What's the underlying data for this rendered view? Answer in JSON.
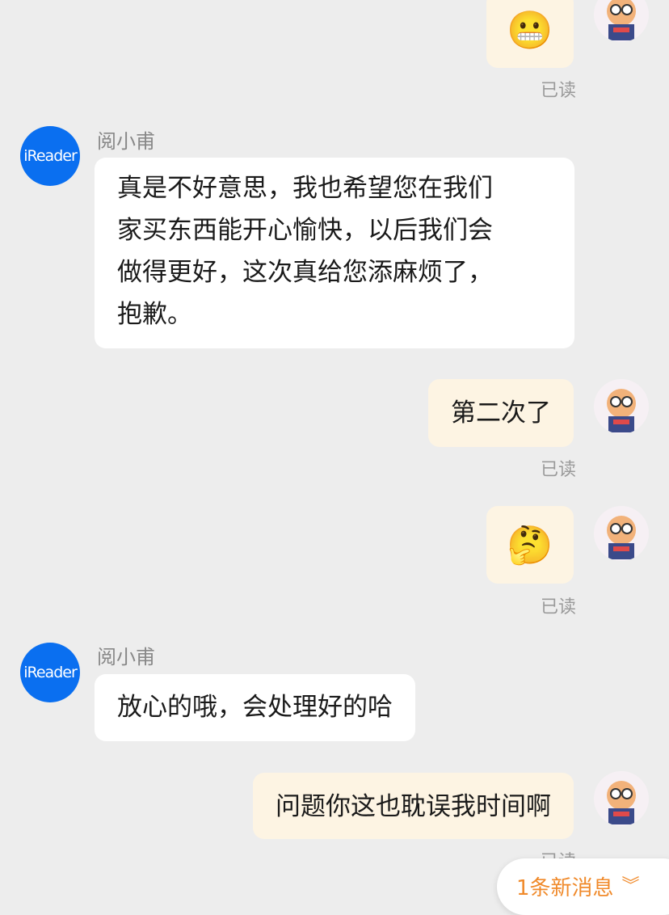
{
  "messages": {
    "m1": {
      "emoji": "😬",
      "read": "已读"
    },
    "m2": {
      "sender": "阅小甫",
      "avatar_text": "iReader",
      "lines": [
        "真是不好意思，我也希望您在我们",
        "家买东西能开心愉快，以后我们会",
        "做得更好，这次真给您添麻烦了，",
        "抱歉。"
      ]
    },
    "m3": {
      "text": "第二次了",
      "read": "已读"
    },
    "m4": {
      "emoji": "🤔",
      "read": "已读"
    },
    "m5": {
      "sender": "阅小甫",
      "avatar_text": "iReader",
      "text": "放心的哦，会处理好的哈"
    },
    "m6": {
      "text": "问题你这也耽误我时间啊",
      "read": "已读"
    }
  },
  "new_message_pill": {
    "label": "1条新消息",
    "icon": "double-chevron-down-icon"
  },
  "colors": {
    "background": "#ededed",
    "incoming_bubble": "#ffffff",
    "outgoing_bubble": "#fdf4e3",
    "accent": "#f08a2b",
    "ireader_blue": "#0a6ff0"
  }
}
